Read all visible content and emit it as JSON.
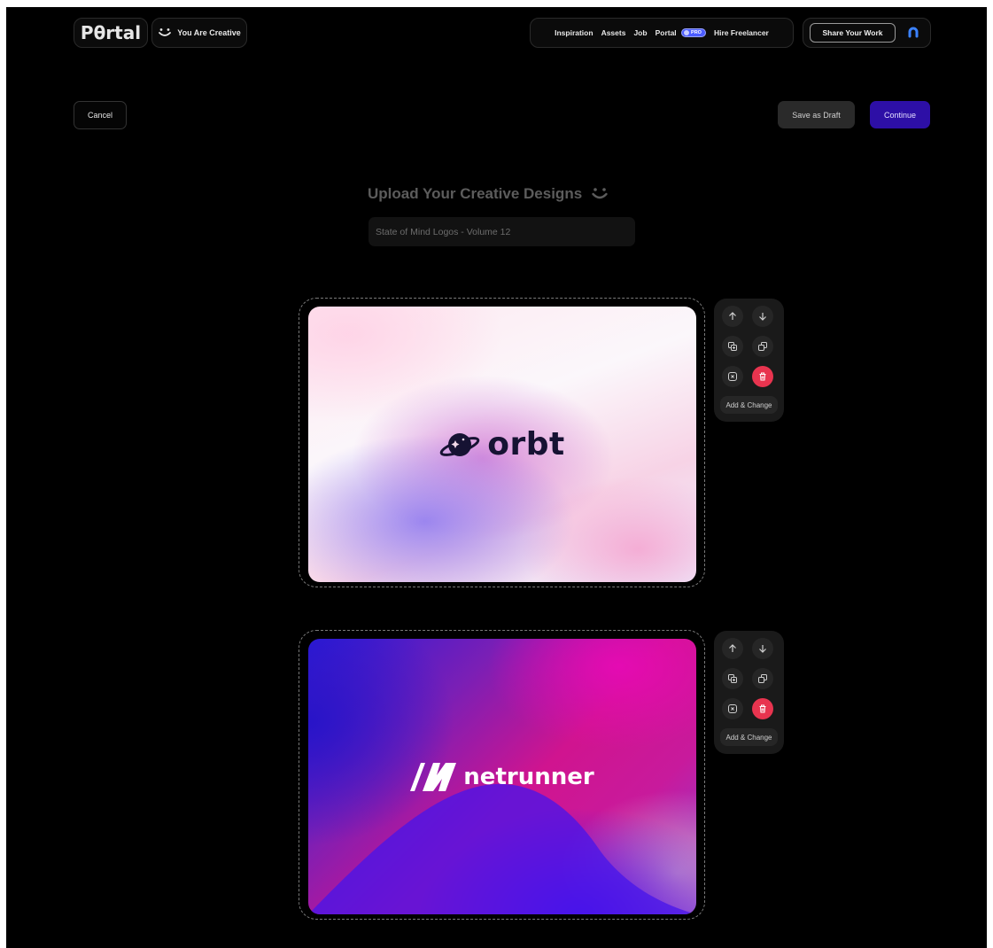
{
  "header": {
    "logo_text": "Pθrtal",
    "tagline": "You Are Creative",
    "nav": {
      "inspiration": "Inspiration",
      "assets": "Assets",
      "job": "Job",
      "portal": "Portal",
      "pro_badge": "PRO",
      "hire": "Hire Freelancer"
    },
    "share_label": "Share Your Work"
  },
  "actions": {
    "cancel": "Cancel",
    "save_draft": "Save as Draft",
    "continue": "Continue"
  },
  "upload": {
    "heading": "Upload Your Creative Designs",
    "title_value": "State of Mind Logos - Volume 12"
  },
  "cards": [
    {
      "logo_text": "orbt",
      "tool_label": "Add & Change"
    },
    {
      "logo_text": "netrunner",
      "tool_label": "Add & Change"
    }
  ],
  "colors": {
    "accent": "#2d0fa6",
    "danger": "#e8344f",
    "pro": "#4b5cff"
  },
  "icons": [
    "smile-icon",
    "user-icon",
    "arrow-up-icon",
    "arrow-down-icon",
    "copy-icon",
    "duplicate-icon",
    "close-icon",
    "trash-icon"
  ]
}
